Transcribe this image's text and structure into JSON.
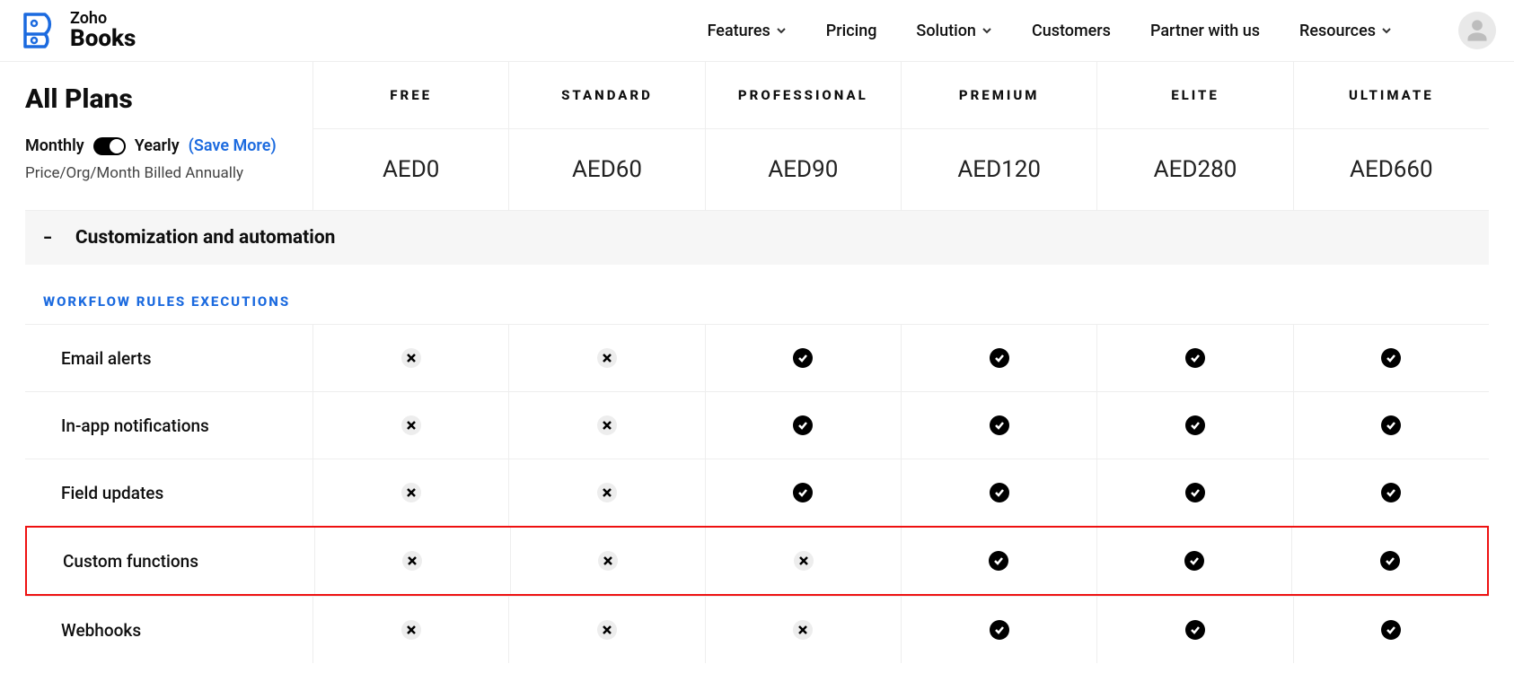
{
  "logo": {
    "line1": "Zoho",
    "line2": "Books"
  },
  "nav": {
    "features": "Features",
    "pricing": "Pricing",
    "solution": "Solution",
    "customers": "Customers",
    "partner": "Partner with us",
    "resources": "Resources"
  },
  "plans": {
    "title": "All Plans",
    "monthly": "Monthly",
    "yearly": "Yearly",
    "save_more": "(Save More)",
    "billed": "Price/Org/Month Billed Annually",
    "cols": [
      {
        "name": "FREE",
        "price": "AED0"
      },
      {
        "name": "STANDARD",
        "price": "AED60"
      },
      {
        "name": "PROFESSIONAL",
        "price": "AED90"
      },
      {
        "name": "PREMIUM",
        "price": "AED120"
      },
      {
        "name": "ELITE",
        "price": "AED280"
      },
      {
        "name": "ULTIMATE",
        "price": "AED660"
      }
    ]
  },
  "section": {
    "title": "Customization and automation"
  },
  "subsection1": "WORKFLOW RULES EXECUTIONS",
  "features": [
    {
      "label": "Email alerts",
      "vals": [
        "x",
        "x",
        "c",
        "c",
        "c",
        "c"
      ],
      "hl": false
    },
    {
      "label": "In-app notifications",
      "vals": [
        "x",
        "x",
        "c",
        "c",
        "c",
        "c"
      ],
      "hl": false
    },
    {
      "label": "Field updates",
      "vals": [
        "x",
        "x",
        "c",
        "c",
        "c",
        "c"
      ],
      "hl": false
    },
    {
      "label": "Custom functions",
      "vals": [
        "x",
        "x",
        "x",
        "c",
        "c",
        "c"
      ],
      "hl": true
    },
    {
      "label": "Webhooks",
      "vals": [
        "x",
        "x",
        "x",
        "c",
        "c",
        "c"
      ],
      "hl": false
    }
  ]
}
